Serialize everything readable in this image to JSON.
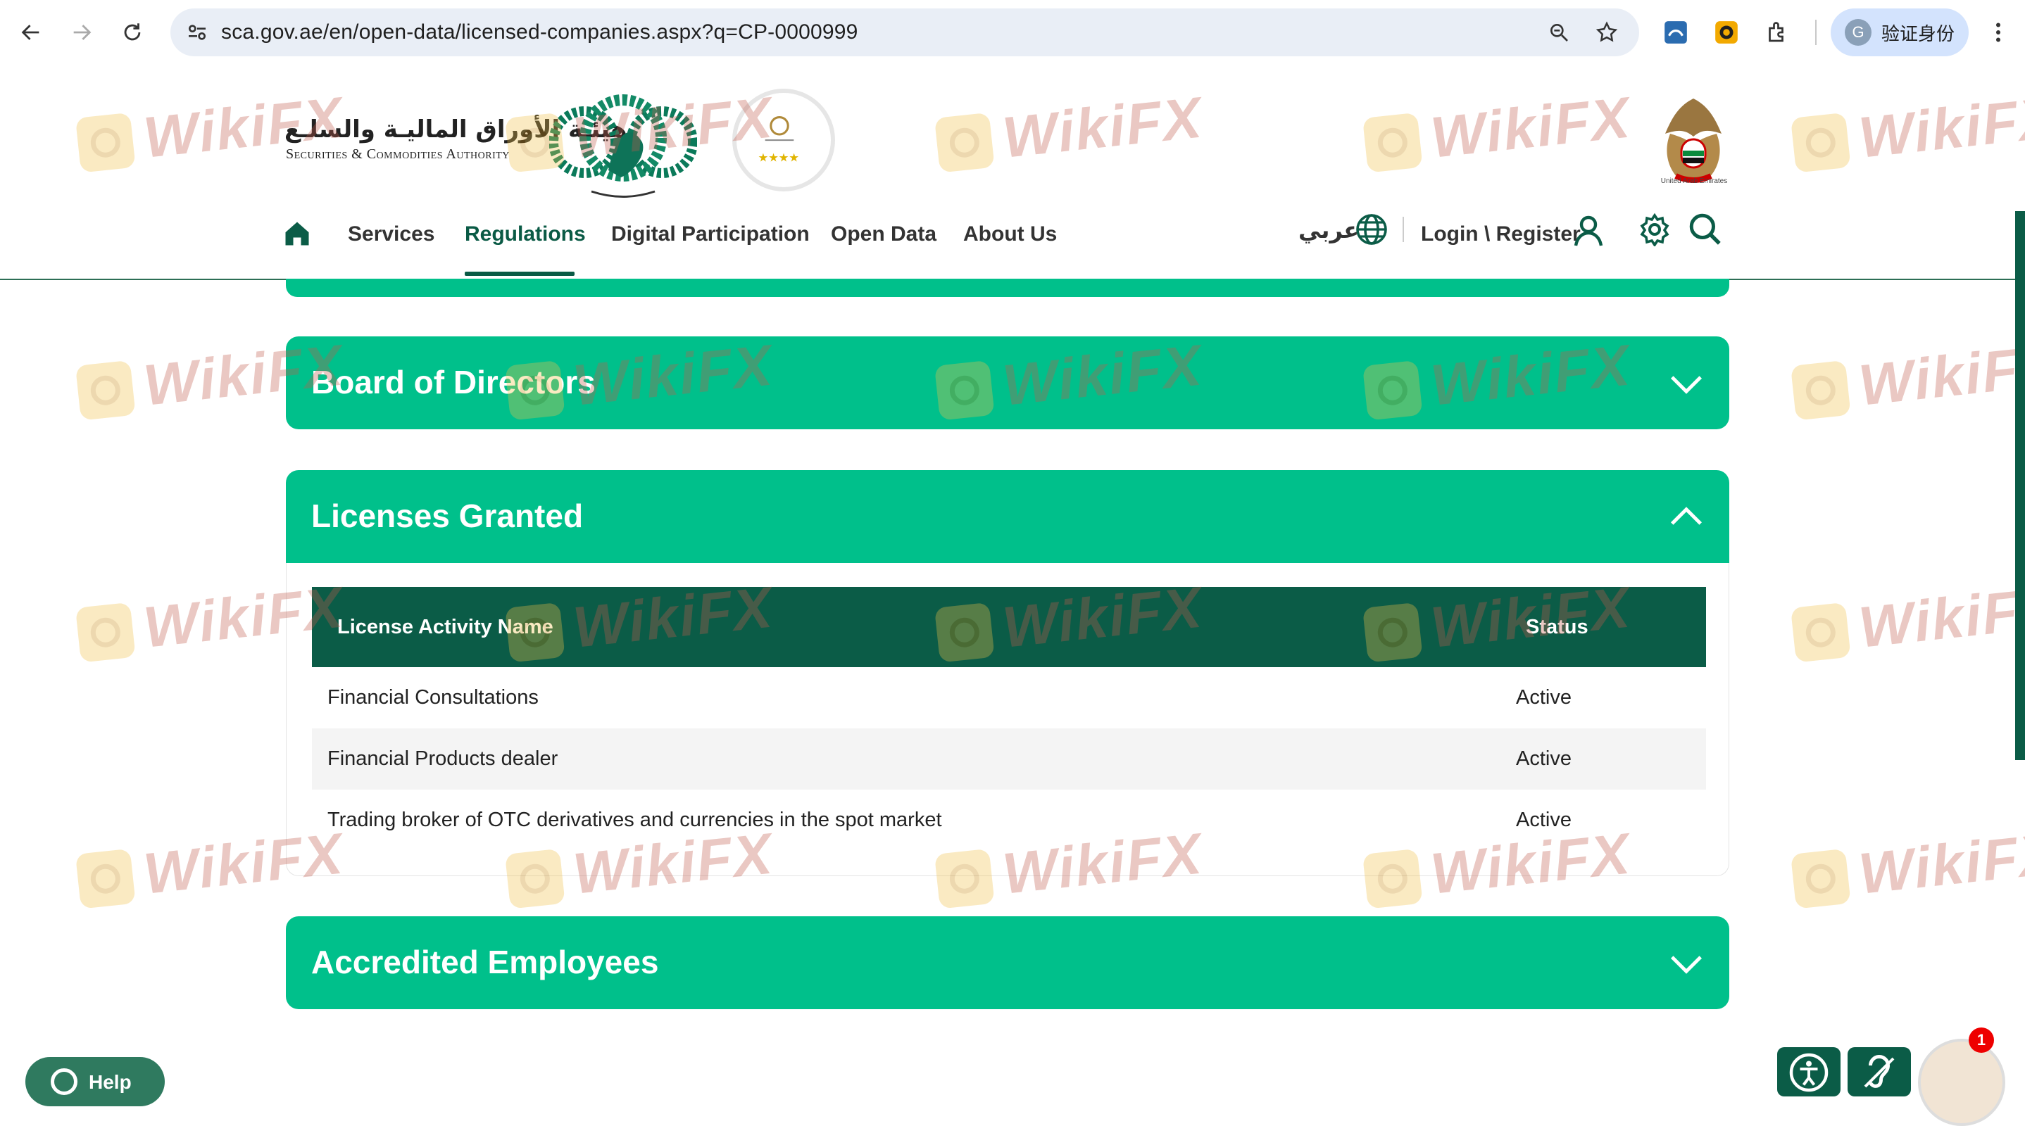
{
  "browser": {
    "url": "sca.gov.ae/en/open-data/licensed-companies.aspx?q=CP-0000999",
    "profile_label": "验证身份",
    "profile_initial": "G"
  },
  "header": {
    "logo_arabic": "هيئـة الأوراق الماليـة والسلـع",
    "logo_english": "Securities & Commodities Authority",
    "uae_caption": "United Arab Emirates",
    "nav": {
      "items": [
        {
          "label": "Services"
        },
        {
          "label": "Regulations",
          "active": true
        },
        {
          "label": "Digital Participation"
        },
        {
          "label": "Open Data"
        },
        {
          "label": "About Us"
        }
      ]
    },
    "arabic_link": "عربي",
    "login_label": "Login \\ Register"
  },
  "sections": {
    "board": {
      "title": "Board of Directors",
      "state": "collapsed"
    },
    "licenses": {
      "title": "Licenses Granted",
      "state": "expanded"
    },
    "employees": {
      "title": "Accredited Employees",
      "state": "collapsed"
    }
  },
  "licenses_table": {
    "columns": [
      "License Activity Name",
      "Status"
    ],
    "rows": [
      {
        "name": "Financial Consultations",
        "status": "Active"
      },
      {
        "name": "Financial Products dealer",
        "status": "Active"
      },
      {
        "name": "Trading broker of OTC derivatives and currencies in the spot market",
        "status": "Active"
      }
    ]
  },
  "watermark": {
    "text": "WikiFX"
  },
  "widgets": {
    "help_label": "Help",
    "notification_count": "1"
  },
  "colors": {
    "accent": "#00c08b",
    "dark_green": "#0b5c47",
    "watermark": "#c25a4b"
  }
}
